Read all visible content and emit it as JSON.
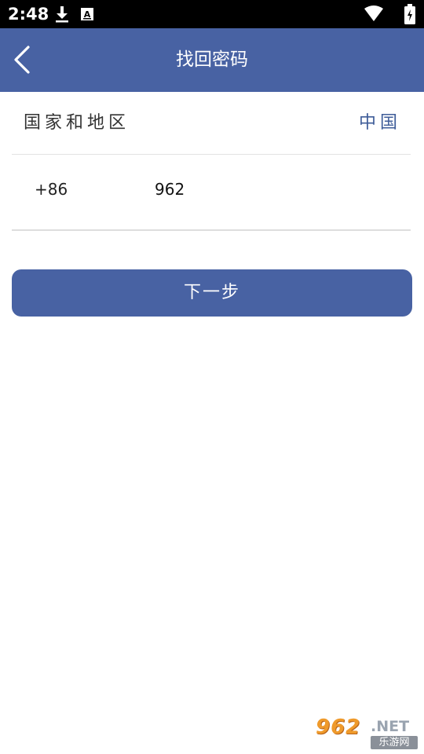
{
  "status_bar": {
    "time": "2:48",
    "icons": [
      "download-icon",
      "a11y-badge-icon",
      "wifi-icon",
      "battery-icon"
    ]
  },
  "header": {
    "title": "找回密码",
    "back_icon": "chevron-left-icon",
    "background": "#4862a3"
  },
  "form": {
    "region_label": "国家和地区",
    "region_value": "中国",
    "country_code": "+86",
    "phone_value": "962"
  },
  "next_button": {
    "label": "下一步"
  },
  "watermark": {
    "brand": "962",
    "domain": ".NET",
    "site_name": "乐游网"
  },
  "colors": {
    "primary": "#4862a3",
    "link_text": "#3f5d99",
    "divider": "#e3e3e3"
  }
}
